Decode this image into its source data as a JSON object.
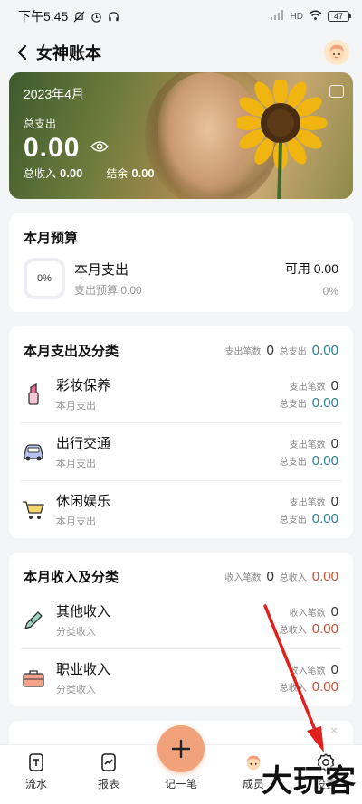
{
  "status_bar": {
    "time": "下午5:45",
    "battery": "47",
    "network": "HD"
  },
  "nav": {
    "title": "女神账本"
  },
  "hero": {
    "month": "2023年4月",
    "expense_label": "总支出",
    "expense_amount": "0.00",
    "income_label": "总收入",
    "income_amount": "0.00",
    "balance_label": "结余",
    "balance_amount": "0.00"
  },
  "budget": {
    "title": "本月预算",
    "ring_percent": "0%",
    "item_title": "本月支出",
    "item_sub": "支出预算 0.00",
    "available": "可用 0.00",
    "percent": "0%"
  },
  "expense_section": {
    "title": "本月支出及分类",
    "count_label": "支出笔数",
    "count": "0",
    "total_label": "总支出",
    "total": "0.00",
    "items": [
      {
        "name": "彩妆保养",
        "sub": "本月支出",
        "count_label": "支出笔数",
        "count": "0",
        "total_label": "总支出",
        "total": "0.00",
        "icon": "lipstick-icon"
      },
      {
        "name": "出行交通",
        "sub": "本月支出",
        "count_label": "支出笔数",
        "count": "0",
        "total_label": "总支出",
        "total": "0.00",
        "icon": "car-icon"
      },
      {
        "name": "休闲娱乐",
        "sub": "本月支出",
        "count_label": "支出笔数",
        "count": "0",
        "total_label": "总支出",
        "total": "0.00",
        "icon": "cart-icon"
      }
    ]
  },
  "income_section": {
    "title": "本月收入及分类",
    "count_label": "收入笔数",
    "count": "0",
    "total_label": "总收入",
    "total": "0.00",
    "items": [
      {
        "name": "其他收入",
        "sub": "分类收入",
        "count_label": "收入笔数",
        "count": "0",
        "total_label": "总收入",
        "total": "0.00",
        "icon": "pencil-icon"
      },
      {
        "name": "职业收入",
        "sub": "分类收入",
        "count_label": "收入笔数",
        "count": "0",
        "total_label": "总收入",
        "total": "0.00",
        "icon": "briefcase-icon"
      }
    ]
  },
  "tabbar": {
    "tab1": "流水",
    "tab2": "报表",
    "tab3": "记一笔",
    "tab4": "成员",
    "tab5": "设置"
  },
  "watermark": "大玩客",
  "colors": {
    "accent": "#f2a27b",
    "teal": "#2f7d8a",
    "red": "#c0553a"
  }
}
